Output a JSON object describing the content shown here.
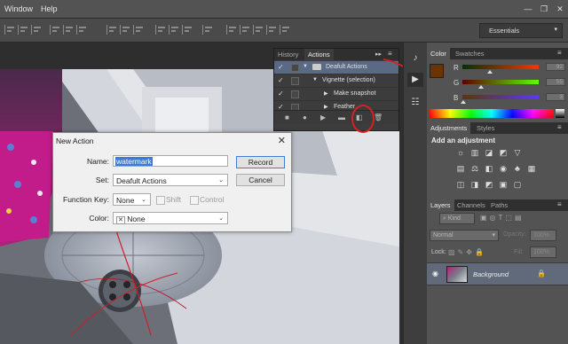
{
  "menubar": {
    "items": [
      "Window",
      "Help"
    ],
    "window_controls": [
      "minimize-icon",
      "restore-icon",
      "close-icon"
    ]
  },
  "workspace": {
    "value": "Essentials"
  },
  "actions_panel": {
    "tabs": [
      "History",
      "Actions"
    ],
    "active_tab": "Actions",
    "rows": [
      {
        "label": "Deafult Actions",
        "selected": true,
        "type": "set"
      },
      {
        "label": "Vignette (selection)",
        "selected": false,
        "type": "action"
      },
      {
        "label": "Make snapshot",
        "selected": false,
        "type": "step"
      },
      {
        "label": "Feather",
        "selected": false,
        "type": "step"
      }
    ],
    "footer_buttons": [
      "stop-icon",
      "record-icon",
      "play-icon",
      "new-set-icon",
      "new-action-icon",
      "delete-icon"
    ]
  },
  "color_panel": {
    "tabs": [
      "Color",
      "Swatches"
    ],
    "active_tab": "Color",
    "foreground": "#6b3300",
    "background": "#ffffff",
    "channels": [
      {
        "name": "R",
        "value": "92"
      },
      {
        "name": "G",
        "value": "55"
      },
      {
        "name": "B",
        "value": "3"
      }
    ]
  },
  "adjustments_panel": {
    "tabs": [
      "Adjustments",
      "Styles"
    ],
    "active_tab": "Adjustments",
    "heading": "Add an adjustment"
  },
  "layers_panel": {
    "tabs": [
      "Layers",
      "Channels",
      "Paths"
    ],
    "active_tab": "Layers",
    "filter_kind": "Kind",
    "blend_mode": "Normal",
    "opacity_label": "Opacity:",
    "opacity_value": "100%",
    "lock_label": "Lock:",
    "fill_label": "Fill:",
    "fill_value": "100%",
    "layer_name": "Background"
  },
  "dialog": {
    "title": "New Action",
    "name_label": "Name:",
    "name_value": "watermark",
    "set_label": "Set:",
    "set_value": "Deafult Actions",
    "fkey_label": "Function Key:",
    "fkey_value": "None",
    "shift_label": "Shift",
    "control_label": "Control",
    "color_label": "Color:",
    "color_value": "None",
    "color_prefix": "✕",
    "record_label": "Record",
    "cancel_label": "Cancel"
  }
}
